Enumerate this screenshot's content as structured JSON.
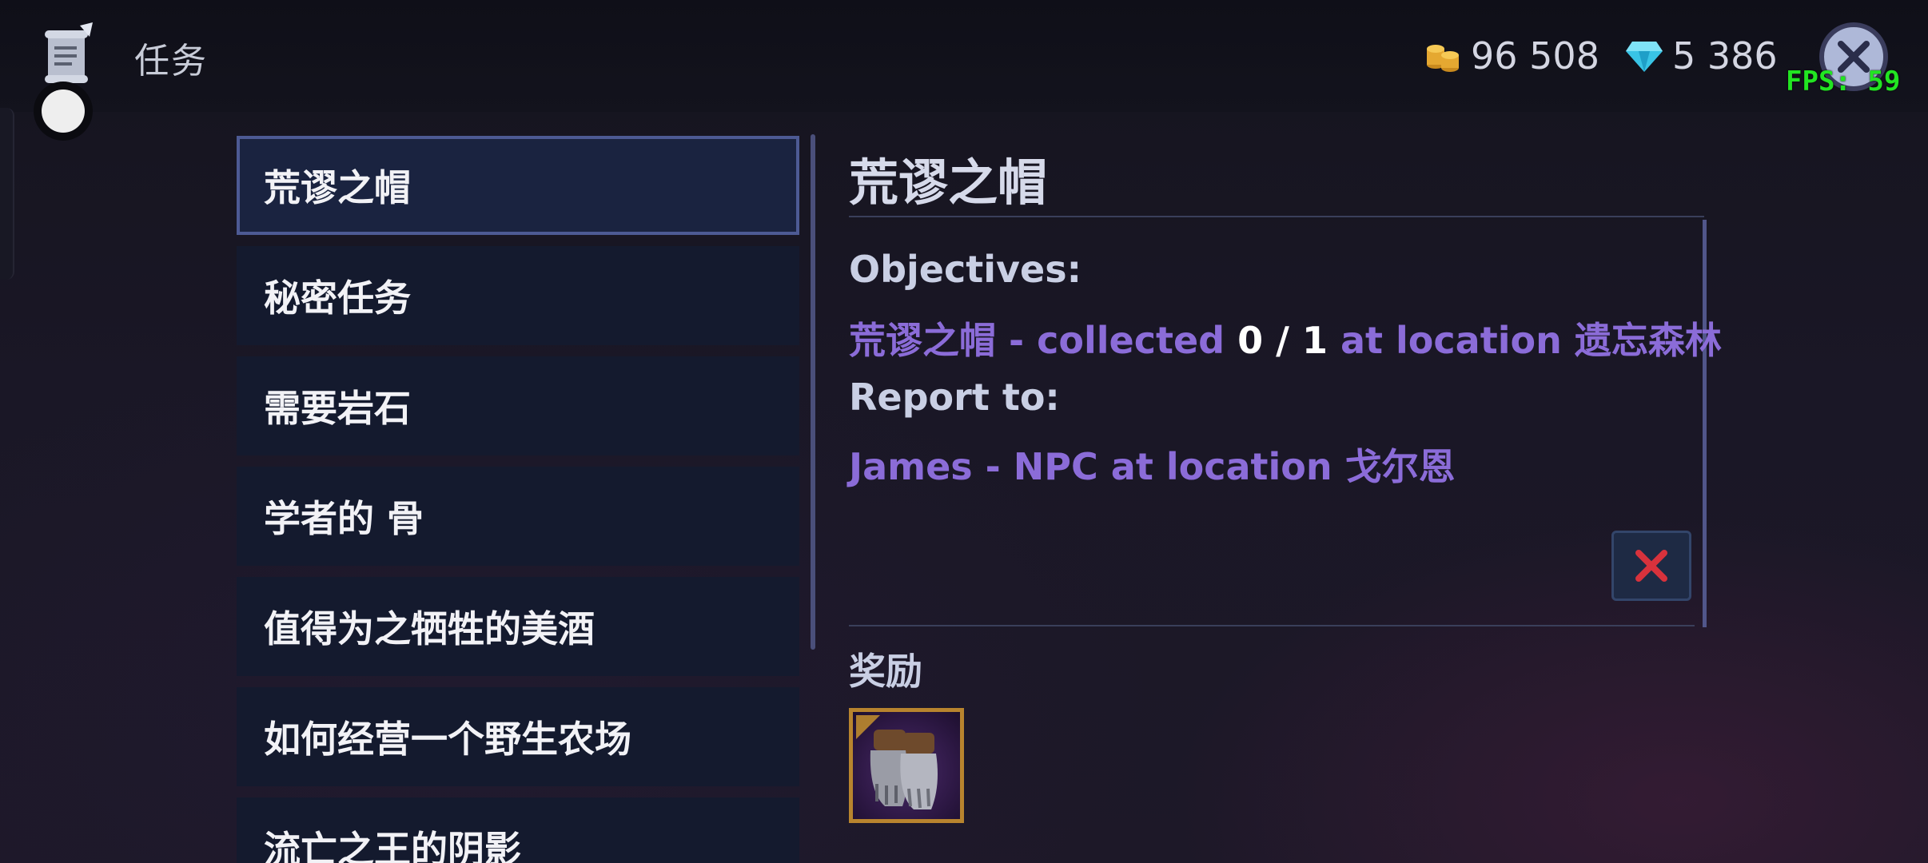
{
  "header": {
    "title": "任务",
    "gold": "96 508",
    "gems": "5 386",
    "fps": "FPS: 59",
    "icons": {
      "quest": "quest-scroll-icon",
      "gold": "gold-coins-icon",
      "gems": "diamond-icon",
      "close": "close-icon"
    }
  },
  "quests": [
    {
      "label": "荒谬之帽",
      "selected": true
    },
    {
      "label": "秘密任务"
    },
    {
      "label": "需要岩石"
    },
    {
      "label": "学者的 骨"
    },
    {
      "label": "值得为之牺牲的美酒"
    },
    {
      "label": "如何经营一个野生农场"
    },
    {
      "label": "流亡之王的阴影"
    }
  ],
  "detail": {
    "title": "荒谬之帽",
    "objectives_label": "Objectives:",
    "objective": {
      "item": "荒谬之帽 - collected",
      "progress": "0 / 1",
      "location": "at location 遗忘森林"
    },
    "report_label": "Report to:",
    "report_line": "James - NPC at location 戈尔恩",
    "rewards_label": "奖励",
    "reward_item_icon": "steel-gauntlets-icon"
  },
  "colors": {
    "accent_purple": "#8b6cd8",
    "fps_green": "#22e522",
    "abandon_red": "#d8323c",
    "reward_frame": "#b8842e"
  }
}
